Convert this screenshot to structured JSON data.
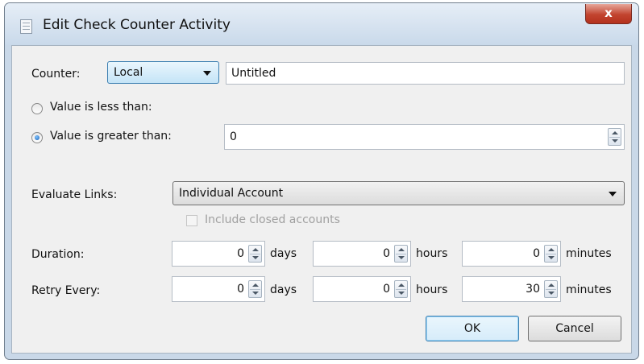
{
  "window": {
    "title": "Edit Check Counter Activity",
    "close_glyph": "x"
  },
  "counter": {
    "label": "Counter:",
    "scope_value": "Local",
    "name_value": "Untitled"
  },
  "value_condition": {
    "less_than_label": "Value is less than:",
    "greater_than_label": "Value is greater than:",
    "selected": "greater_than",
    "threshold_value": "0"
  },
  "evaluate_links": {
    "label": "Evaluate Links:",
    "value": "Individual Account",
    "include_closed_label": "Include closed accounts",
    "include_closed_checked": false,
    "include_closed_enabled": false
  },
  "duration": {
    "label": "Duration:",
    "days": "0",
    "hours": "0",
    "minutes": "0"
  },
  "retry": {
    "label": "Retry Every:",
    "days": "0",
    "hours": "0",
    "minutes": "30"
  },
  "units": {
    "days": "days",
    "hours": "hours",
    "minutes": "minutes"
  },
  "buttons": {
    "ok": "OK",
    "cancel": "Cancel"
  },
  "icons": {
    "title": "dialog-icon",
    "close": "close-icon",
    "dropdown": "chevron-down-icon",
    "spinner": "spinner-icon"
  }
}
